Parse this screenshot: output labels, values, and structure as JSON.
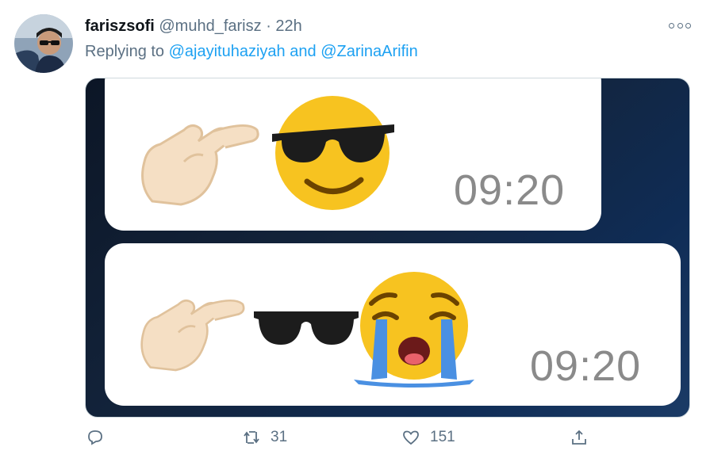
{
  "tweet": {
    "display_name": "fariszsofi",
    "handle": "@muhd_farisz",
    "separator": "·",
    "time": "22h",
    "replying_prefix": "Replying to",
    "mention_1": "@ajayituhaziyah",
    "and_word": "and",
    "mention_2": "@ZarinaArifin",
    "avatar_icon": "profile-photo"
  },
  "media": {
    "message_1_time": "09:20",
    "message_2_time": "09:20",
    "message_1_emojis": [
      "pinching-hand",
      "smiling-face-with-sunglasses"
    ],
    "message_2_emojis": [
      "pinching-hand",
      "sunglasses",
      "loudly-crying-face"
    ]
  },
  "actions": {
    "reply_icon": "reply-icon",
    "retweet_count": "31",
    "like_count": "151",
    "share_icon": "share-icon"
  },
  "colors": {
    "link": "#1da1f2",
    "muted": "#5b7083",
    "emoji_yellow": "#f7c320"
  }
}
